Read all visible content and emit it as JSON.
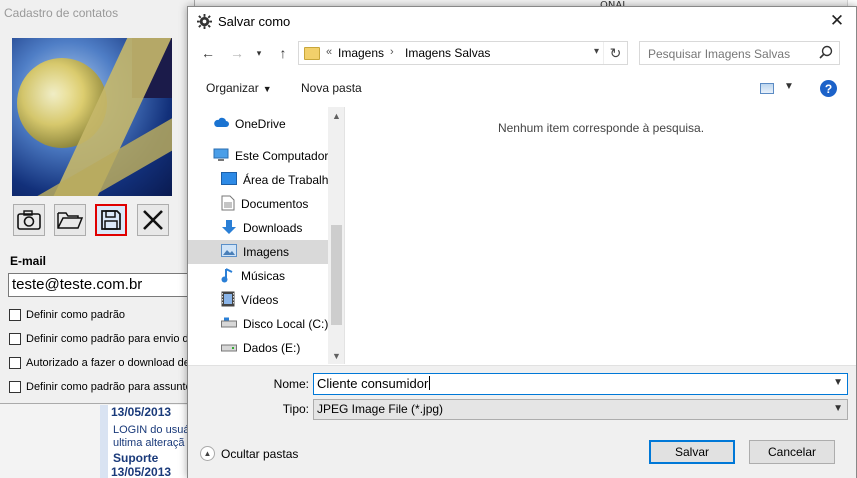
{
  "background": {
    "top_text": "ONAL",
    "list": {
      "date1": "13/05/2013",
      "line1": "LOGIN do usuá",
      "line2": "ultima alteraçã",
      "support": "Suporte",
      "date2": "13/05/2013"
    }
  },
  "cadastro": {
    "title": "Cadastro de contatos",
    "tools": [
      {
        "name": "camera-icon"
      },
      {
        "name": "folder-open-icon"
      },
      {
        "name": "save-icon"
      },
      {
        "name": "close-x-icon"
      }
    ],
    "email_label": "E-mail",
    "email_value": "teste@teste.com.br",
    "checkboxes": [
      "Definir como padrão",
      "Definir como padrão para envio de",
      "Autorizado a fazer o download de",
      "Definir como padrão para assunto"
    ]
  },
  "dialog": {
    "title": "Salvar como",
    "address": {
      "prefix": "«",
      "crumbs": [
        "Imagens",
        "Imagens Salvas"
      ]
    },
    "search_placeholder": "Pesquisar Imagens Salvas",
    "toolbar": {
      "organize": "Organizar",
      "new_folder": "Nova pasta"
    },
    "nav": [
      {
        "label": "OneDrive",
        "icon": "cloud-icon",
        "active": false
      },
      {
        "label": "Este Computador",
        "icon": "computer-icon",
        "active": false
      },
      {
        "label": "Área de Trabalho",
        "icon": "desktop-icon",
        "active": false
      },
      {
        "label": "Documentos",
        "icon": "documents-icon",
        "active": false
      },
      {
        "label": "Downloads",
        "icon": "download-icon",
        "active": false
      },
      {
        "label": "Imagens",
        "icon": "pictures-icon",
        "active": true
      },
      {
        "label": "Músicas",
        "icon": "music-icon",
        "active": false
      },
      {
        "label": "Vídeos",
        "icon": "video-icon",
        "active": false
      },
      {
        "label": "Disco Local (C:)",
        "icon": "drive-icon",
        "active": false
      },
      {
        "label": "Dados (E:)",
        "icon": "drive-icon",
        "active": false
      }
    ],
    "empty_message": "Nenhum item corresponde à pesquisa.",
    "name_label": "Nome:",
    "name_value": "Cliente consumidor",
    "type_label": "Tipo:",
    "type_value": "JPEG Image File (*.jpg)",
    "hide_folders": "Ocultar pastas",
    "save_label": "Salvar",
    "cancel_label": "Cancelar"
  },
  "colors": {
    "accent": "#0078d7",
    "selected_tool_border": "#e00000",
    "active_nav": "#d9d9d9"
  }
}
